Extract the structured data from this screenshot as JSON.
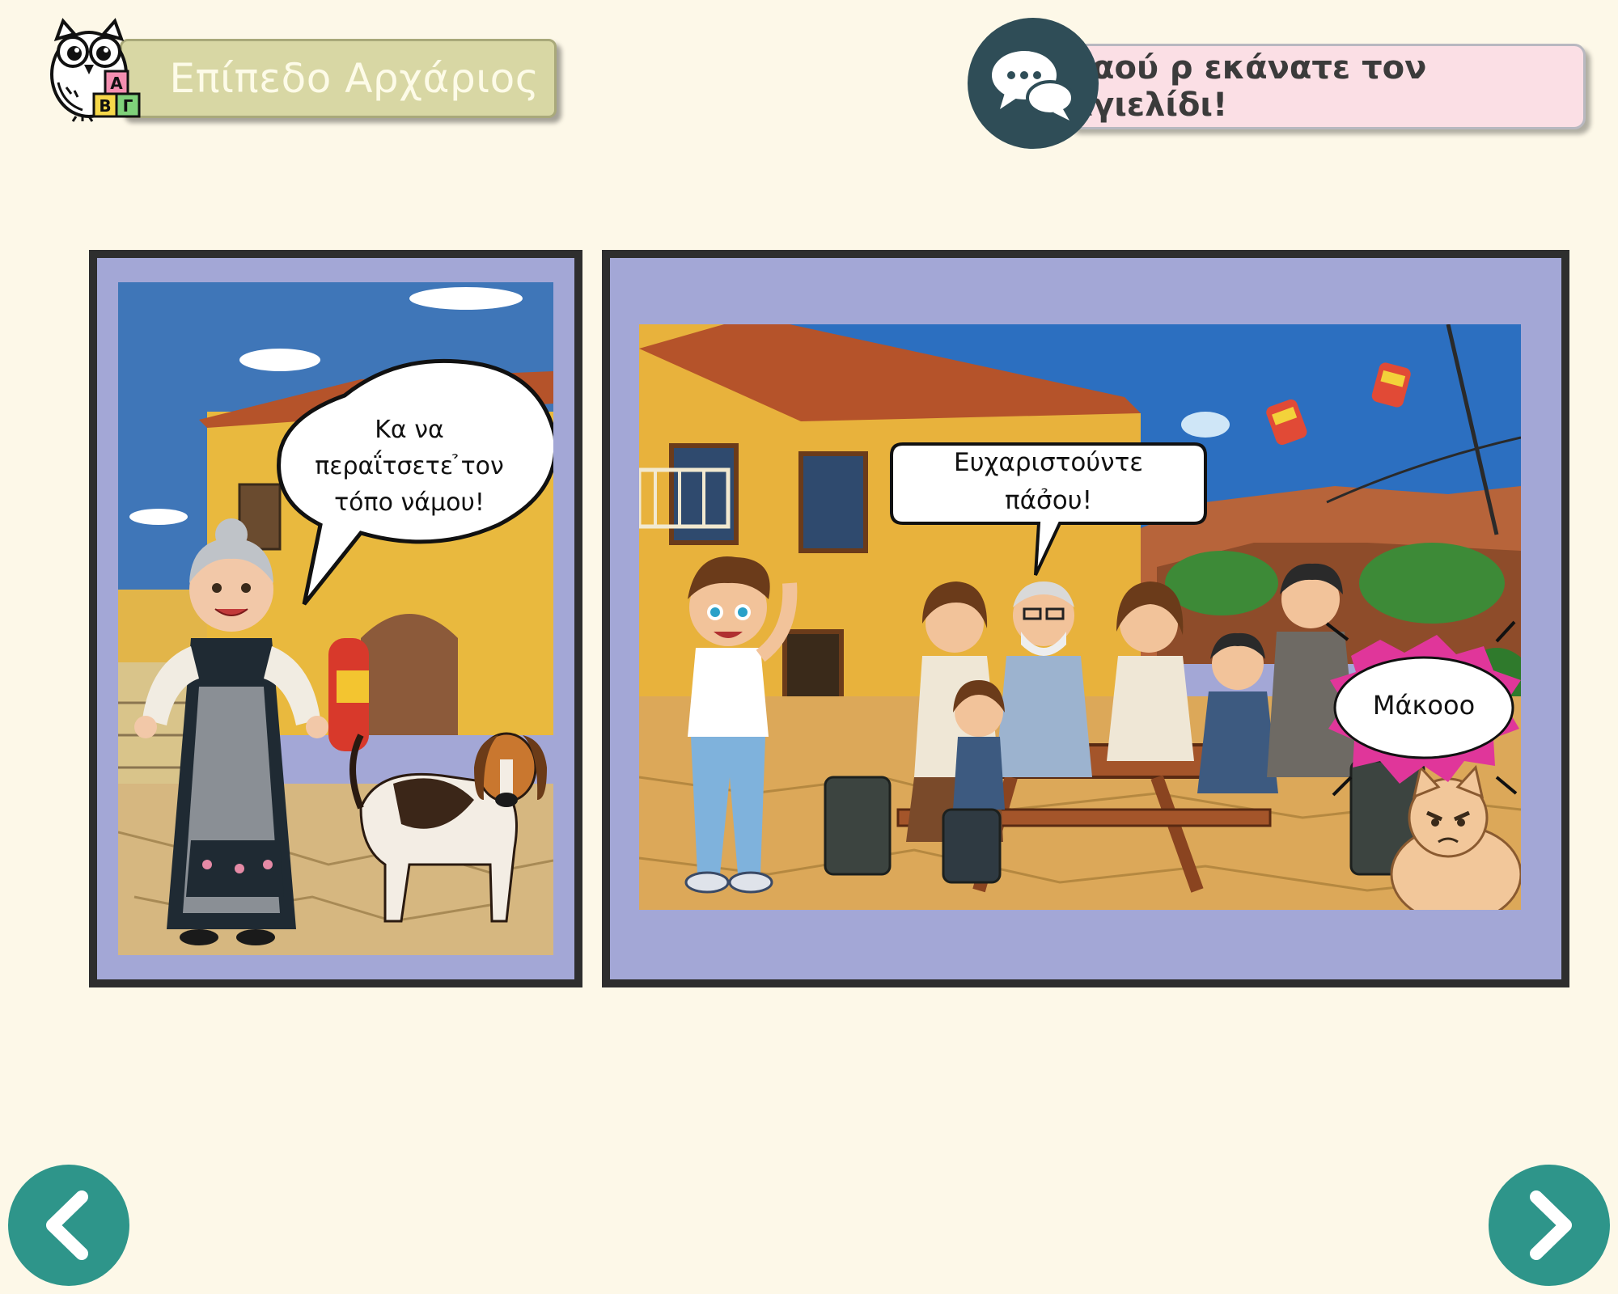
{
  "header": {
    "level_label": "Επίπεδο Αρχάριος",
    "owl_block_letters": [
      "Α",
      "Β",
      "Γ"
    ],
    "subtitle": "Καού ρ εκάνατε τον Αγιελίδι!",
    "icons": {
      "owl": "owl-logo-icon",
      "chat": "chat-bubbles-icon"
    }
  },
  "panels": [
    {
      "bubble_lines": [
        "Κα να",
        "περαΐτσετε ̉τον",
        "τόπο νάμου!"
      ]
    },
    {
      "bubble_lines": [
        "Ευχαριστούντε",
        "πάσ̉ου!"
      ],
      "shout": "Μάκοοο"
    }
  ],
  "nav": {
    "prev_icon": "chevron-left-icon",
    "next_icon": "chevron-right-icon"
  },
  "colors": {
    "background": "#fdf8e8",
    "panel_fill": "#a3a7d6",
    "level_pill": "#d8d7a4",
    "subtitle_pill": "#fbdfe5",
    "chat_circle": "#2f4d57",
    "nav_button": "#2e958a"
  }
}
